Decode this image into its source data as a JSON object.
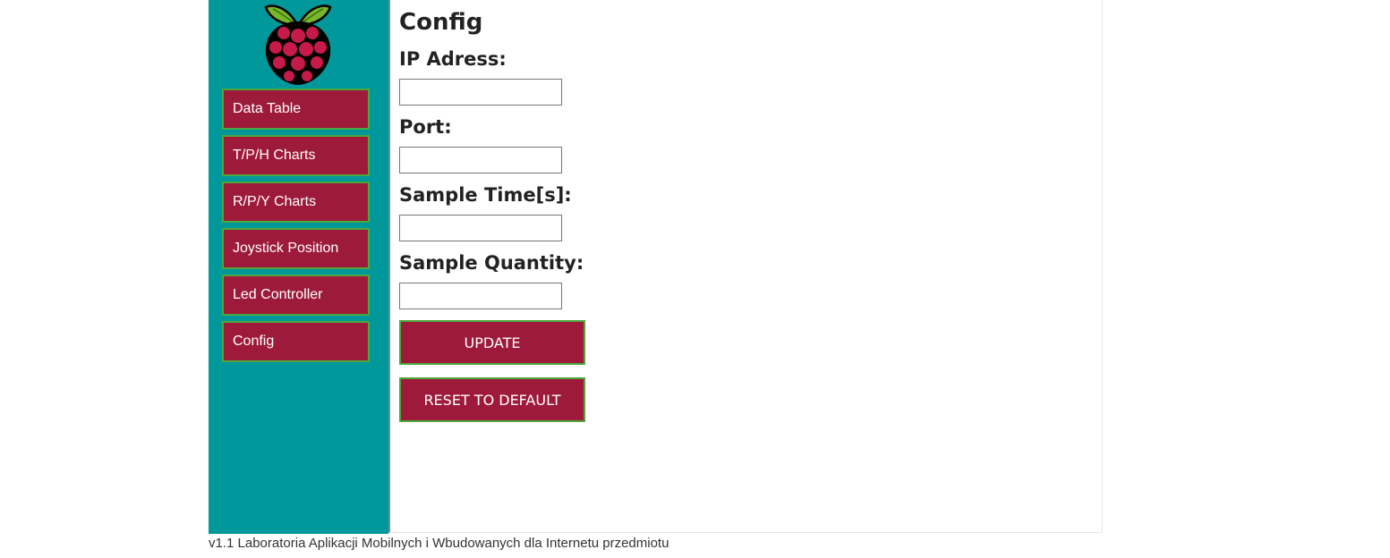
{
  "sidebar": {
    "logo": "raspberry-pi-logo",
    "items": [
      {
        "label": "Data Table"
      },
      {
        "label": "T/P/H Charts"
      },
      {
        "label": "R/P/Y Charts"
      },
      {
        "label": "Joystick Position"
      },
      {
        "label": "Led Controller"
      },
      {
        "label": "Config"
      }
    ]
  },
  "main": {
    "title": "Config",
    "fields": [
      {
        "label": "IP Adress:",
        "value": ""
      },
      {
        "label": "Port:",
        "value": ""
      },
      {
        "label": "Sample Time[s]:",
        "value": ""
      },
      {
        "label": "Sample Quantity:",
        "value": ""
      }
    ],
    "update_label": "UPDATE",
    "reset_label": "RESET TO DEFAULT"
  },
  "footer": {
    "text": "v1.1 Laboratoria Aplikacji Mobilnych i Wbudowanych dla Internetu przedmiotu"
  },
  "colors": {
    "sidebar_bg": "#00989a",
    "button_bg": "#9e1a3a",
    "button_border": "#4ca83c"
  }
}
